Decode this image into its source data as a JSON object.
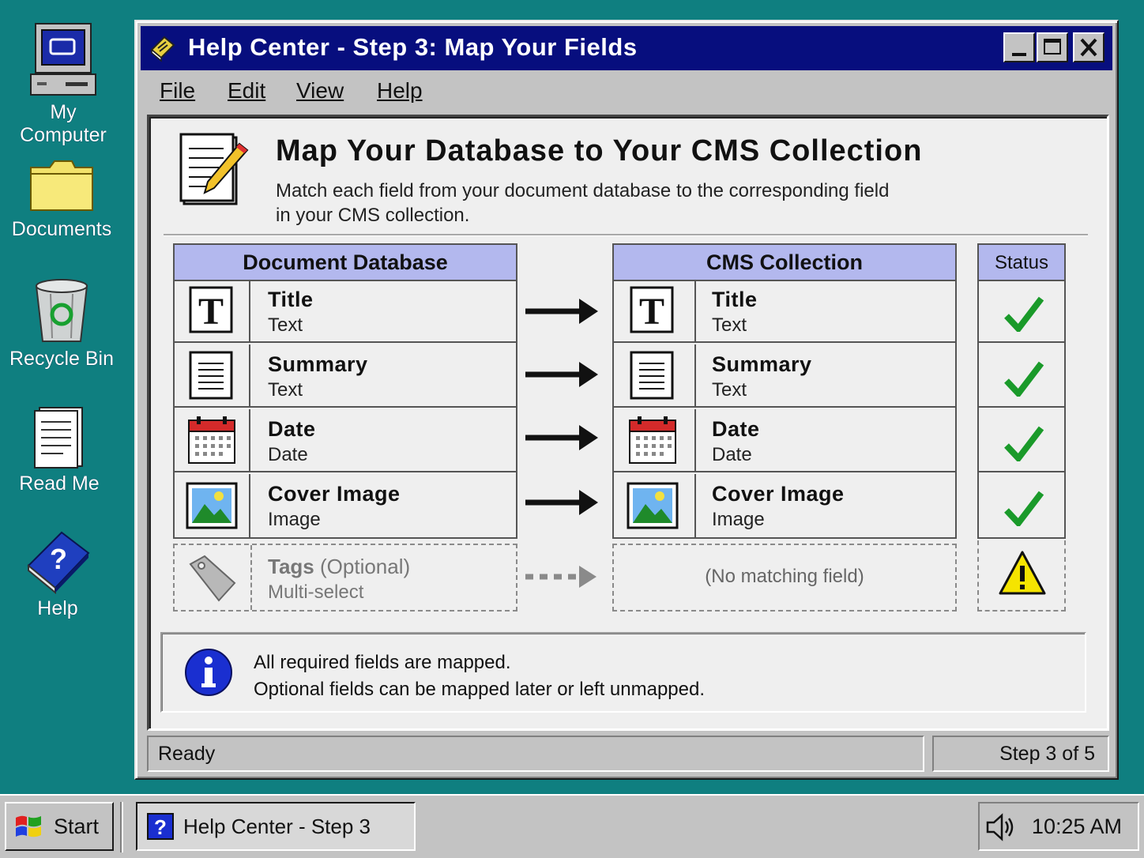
{
  "desktop": {
    "icons": [
      {
        "label": "My Computer"
      },
      {
        "label": "Documents"
      },
      {
        "label": "Recycle Bin"
      },
      {
        "label": "Read Me"
      },
      {
        "label": "Help"
      }
    ]
  },
  "window": {
    "title": "Help Center - Step 3: Map Your Fields",
    "menu": [
      "File",
      "Edit",
      "View",
      "Help"
    ],
    "heading": "Map Your Database to Your CMS Collection",
    "description": "Match each field from your document database to the corresponding field in your CMS collection.",
    "source_header": "Document Database",
    "target_header": "CMS Collection",
    "status_header": "Status",
    "mappings": [
      {
        "source_name": "Title",
        "source_type": "Text",
        "target_name": "Title",
        "target_type": "Text",
        "icon": "text-t-icon",
        "status": "check"
      },
      {
        "source_name": "Summary",
        "source_type": "Text",
        "target_name": "Summary",
        "target_type": "Text",
        "icon": "document-lines-icon",
        "status": "check"
      },
      {
        "source_name": "Date",
        "source_type": "Date",
        "target_name": "Date",
        "target_type": "Date",
        "icon": "calendar-icon",
        "status": "check"
      },
      {
        "source_name": "Cover Image",
        "source_type": "Image",
        "target_name": "Cover Image",
        "target_type": "Image",
        "icon": "image-icon",
        "status": "check"
      }
    ],
    "optional": {
      "name": "Tags",
      "qualifier": "(Optional)",
      "type": "Multi-select",
      "target": "(No matching field)",
      "icon": "tag-icon",
      "status": "warning"
    },
    "info_line1": "All required fields are mapped.",
    "info_line2": "Optional fields can be mapped later or left unmapped.",
    "status_left": "Ready",
    "status_right": "Step 3 of 5"
  },
  "taskbar": {
    "start": "Start",
    "task": "Help Center - Step 3",
    "clock": "10:25 AM"
  },
  "colors": {
    "desktop": "#0f7f80",
    "titlebar": "#070e7e",
    "table_header": "#b3b8ee",
    "check": "#1a9a2a",
    "warning": "#f5e400"
  }
}
